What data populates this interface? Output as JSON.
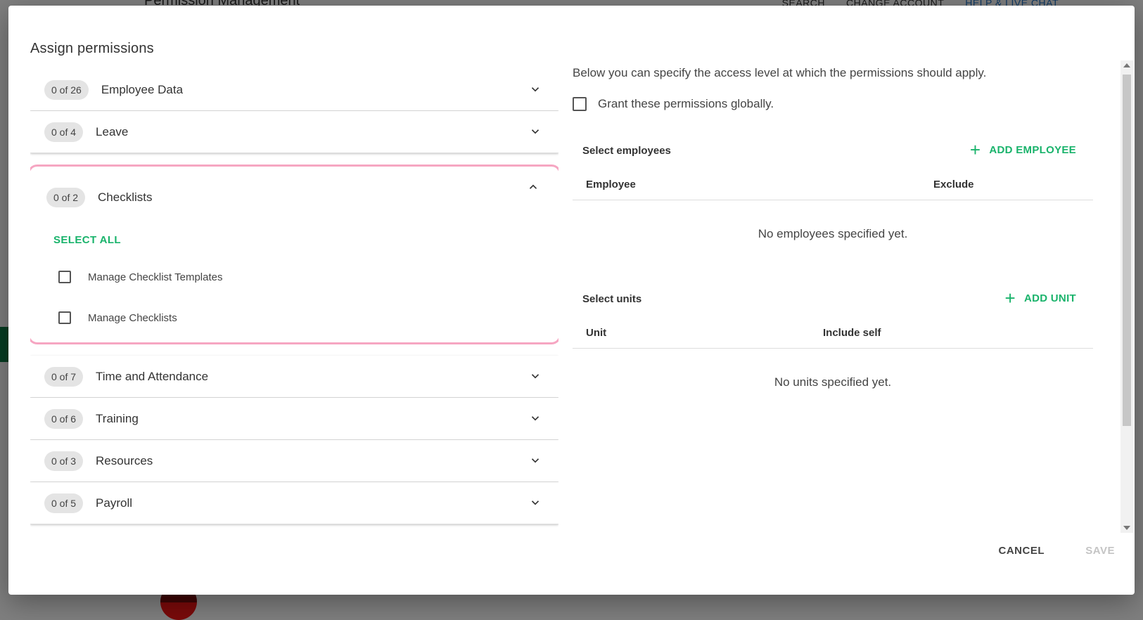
{
  "background": {
    "page_title": "Permission Management",
    "top_links": [
      "SEARCH",
      "CHANGE ACCOUNT",
      "HELP & LIVE CHAT"
    ]
  },
  "dialog": {
    "title": "Assign permissions",
    "categories": [
      {
        "count": "0 of 26",
        "title": "Employee Data",
        "expanded": false
      },
      {
        "count": "0 of 4",
        "title": "Leave",
        "expanded": false
      },
      {
        "count": "0 of 2",
        "title": "Checklists",
        "expanded": true
      },
      {
        "count": "0 of 7",
        "title": "Time and Attendance",
        "expanded": false
      },
      {
        "count": "0 of 6",
        "title": "Training",
        "expanded": false
      },
      {
        "count": "0 of 3",
        "title": "Resources",
        "expanded": false
      },
      {
        "count": "0 of 5",
        "title": "Payroll",
        "expanded": false
      }
    ],
    "select_all_label": "SELECT ALL",
    "checklist_permissions": [
      {
        "label": "Manage Checklist Templates",
        "checked": false
      },
      {
        "label": "Manage Checklists",
        "checked": false
      }
    ],
    "right": {
      "intro": "Below you can specify the access level at which the permissions should apply.",
      "global_label": "Grant these permissions globally.",
      "employees": {
        "heading": "Select employees",
        "add_label": "ADD EMPLOYEE",
        "col_employee": "Employee",
        "col_exclude": "Exclude",
        "empty": "No employees specified yet."
      },
      "units": {
        "heading": "Select units",
        "add_label": "ADD UNIT",
        "col_unit": "Unit",
        "col_include_self": "Include self",
        "empty": "No units specified yet."
      }
    },
    "footer": {
      "cancel_label": "CANCEL",
      "save_label": "SAVE"
    }
  },
  "colors": {
    "accent_green": "#19b36b",
    "highlight_pink": "#f6a6c2",
    "disabled_text": "#c4c4c4"
  }
}
